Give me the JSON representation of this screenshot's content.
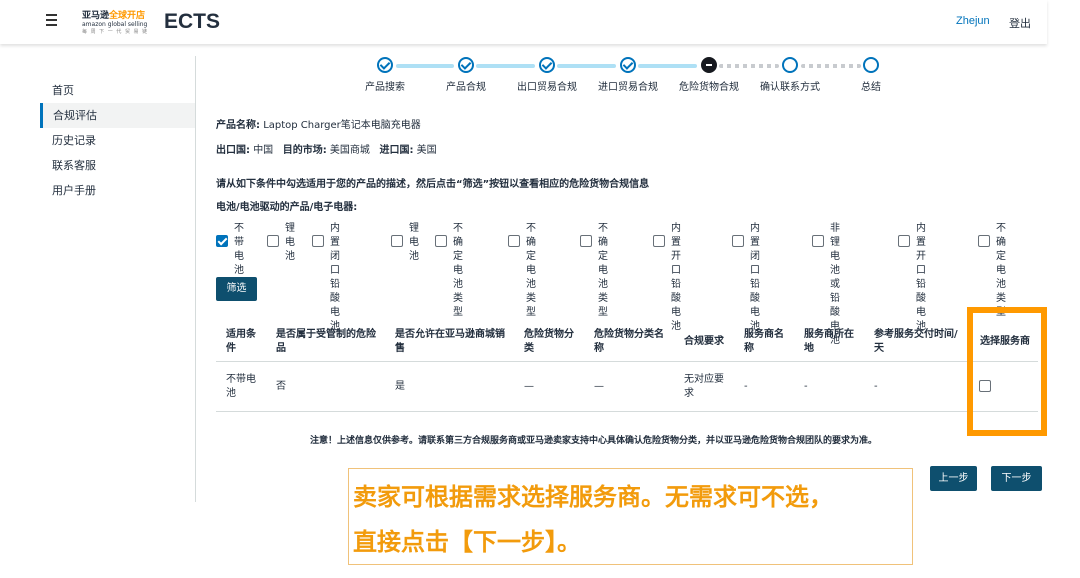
{
  "header": {
    "logo_line1_a": "亚马逊",
    "logo_line1_b": "全球开店",
    "logo_line2": "amazon global selling",
    "logo_line3": "每 周 下 一 代 贸 易 链",
    "app_title": "ECTS",
    "user": "Zhejun",
    "logout": "登出"
  },
  "sidebar": {
    "items": [
      {
        "label": "首页"
      },
      {
        "label": "合规评估"
      },
      {
        "label": "历史记录"
      },
      {
        "label": "联系客服"
      },
      {
        "label": "用户手册"
      }
    ]
  },
  "stepper": {
    "steps": [
      {
        "label": "产品搜索",
        "state": "done"
      },
      {
        "label": "产品合规",
        "state": "done"
      },
      {
        "label": "出口贸易合规",
        "state": "done"
      },
      {
        "label": "进口贸易合规",
        "state": "done"
      },
      {
        "label": "危险货物合规",
        "state": "current"
      },
      {
        "label": "确认联系方式",
        "state": "todo"
      },
      {
        "label": "总结",
        "state": "todo"
      }
    ]
  },
  "product": {
    "name_label": "产品名称:",
    "name_value": "Laptop Charger笔记本电脑充电器",
    "export_label": "出口国:",
    "export_value": "中国",
    "market_label": "目的市场:",
    "market_value": "美国商城",
    "import_label": "进口国:",
    "import_value": "美国"
  },
  "instruction": "请从如下条件中勾选适用于您的产品的描述，然后点击“筛选”按钮以查看相应的危险货物合规信息",
  "subhead": "电池/电池驱动的产品/电子电器:",
  "options": [
    {
      "lines": [
        "不带",
        "电池"
      ],
      "checked": true
    },
    {
      "lines": [
        "锂",
        "电",
        "池"
      ],
      "checked": false
    },
    {
      "lines": [
        "内置闭口",
        "铅酸电池"
      ],
      "checked": false
    },
    {
      "lines": [
        "锂",
        "电",
        "池"
      ],
      "checked": false
    },
    {
      "lines": [
        "不确定电",
        "池类型"
      ],
      "checked": false
    },
    {
      "lines": [
        "不确定电",
        "池类型"
      ],
      "checked": false
    },
    {
      "lines": [
        "不确定电",
        "池类型"
      ],
      "checked": false
    },
    {
      "lines": [
        "内置开口",
        "铅酸电池"
      ],
      "checked": false
    },
    {
      "lines": [
        "内置闭口",
        "铅酸电池"
      ],
      "checked": false
    },
    {
      "lines": [
        "非锂电池或",
        "铅酸电池"
      ],
      "checked": false
    },
    {
      "lines": [
        "内置开口",
        "铅酸电池"
      ],
      "checked": false
    },
    {
      "lines": [
        "不确定电",
        "池类型"
      ],
      "checked": false
    }
  ],
  "filter_button": "筛选",
  "table": {
    "headers": [
      [
        "适用条",
        "件"
      ],
      [
        "是否属于受管制的危险",
        "品"
      ],
      [
        "是否允许在亚马逊商城销",
        "售"
      ],
      [
        "危险货物分",
        "类"
      ],
      [
        "危险货物分类名",
        "称"
      ],
      [
        "合规要求"
      ],
      [
        "服务商名",
        "称"
      ],
      [
        "服务商所在",
        "地"
      ],
      [
        "参考服务交付时间/",
        "天"
      ],
      [
        "选择服务商"
      ]
    ],
    "row": [
      [
        "不带电",
        "池"
      ],
      [
        "否"
      ],
      [
        "是"
      ],
      [
        "—"
      ],
      [
        "—"
      ],
      [
        "无对应要",
        "求"
      ],
      [
        "-"
      ],
      [
        "-"
      ],
      [
        "-"
      ],
      []
    ]
  },
  "note": "注意！上述信息仅供参考。请联系第三方合规服务商或亚马逊卖家支持中心具体确认危险货物分类，并以亚马逊危险货物合规团队的要求为准。",
  "buttons": {
    "prev": "上一步",
    "next": "下一步"
  },
  "callout": {
    "line1": "卖家可根据需求选择服务商。无需求可不选，",
    "line2": "直接点击【下一步】。"
  },
  "colors": {
    "accent": "#0073bb",
    "primary_button": "#0e4f6e",
    "highlight": "#ff9900",
    "callout_text": "#f29b0c"
  }
}
